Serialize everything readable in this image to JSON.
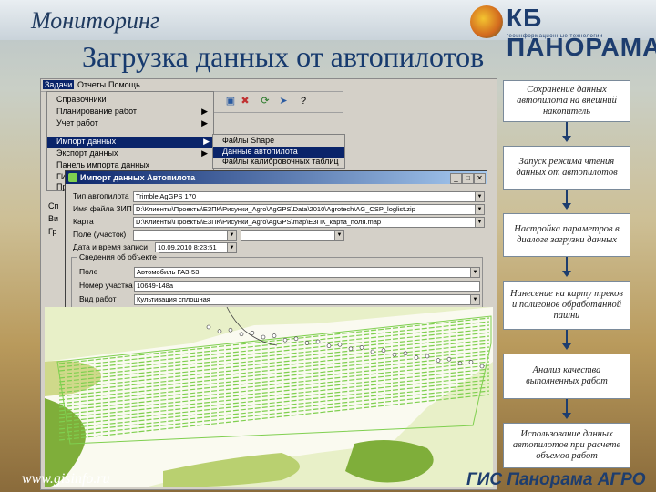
{
  "header": {
    "section_title": "Мониторинг",
    "main_title": "Загрузка данных от автопилотов"
  },
  "logo": {
    "name": "КБ ПАНОРАМА",
    "tagline": "геоинформационные технологии"
  },
  "app": {
    "menubar": [
      "Задачи",
      "Отчеты",
      "Помощь"
    ],
    "menu": [
      {
        "label": "Справочники",
        "arrow": false
      },
      {
        "label": "Планирование работ",
        "arrow": true
      },
      {
        "label": "Учет работ",
        "arrow": true
      },
      {
        "label": "Импорт данных",
        "arrow": true,
        "selected": true
      },
      {
        "label": "Экспорт данных",
        "arrow": true
      },
      {
        "label": "Панель импорта данных",
        "arrow": false
      },
      {
        "label": "ГИС",
        "arrow": false
      },
      {
        "label": "Пр",
        "arrow": false
      }
    ],
    "submenu": [
      {
        "label": "Файлы Shape"
      },
      {
        "label": "Данные автопилота",
        "selected": true
      },
      {
        "label": "Файлы калибровочных таблиц"
      }
    ],
    "side_menu_fragments": [
      "Сп",
      "Ви",
      "Гр"
    ],
    "dialog": {
      "title": "Импорт данных Автопилота",
      "fields": [
        {
          "label": "Тип автопилота",
          "value": "Trimble AgGPS 170",
          "drop": true
        },
        {
          "label": "Имя файла ЗИП",
          "value": "D:\\Клиенты\\Проекты\\ЕЗПК\\Рисунки_Agro\\AgGPS\\Data\\2010\\Agrotech\\AG_CSP_loglist.zip",
          "drop": true
        },
        {
          "label": "Карта",
          "value": "D:\\Клиенты\\Проекты\\ЕЗПК\\Рисунки_Agro\\AgGPS\\map\\ЕЗПК_карта_поля.map",
          "drop": true
        },
        {
          "label": "Поле (участок)",
          "value": "",
          "drop": true,
          "extra": ""
        },
        {
          "label": "Дата и время записи",
          "value": "10.09.2010 8:23:51",
          "drop": true
        }
      ],
      "group_title": "Сведения об объекте",
      "group_fields": [
        {
          "label": "Поле",
          "value": "Автомобиль ГАЗ-53",
          "drop": true
        },
        {
          "label": "Номер участка",
          "value": "10649-148а",
          "drop": false
        },
        {
          "label": "Вид работ",
          "value": "Культивация сплошная",
          "drop": true
        }
      ]
    }
  },
  "flowchart": {
    "steps": [
      "Сохранение данных автопилота на внешний накопитель",
      "Запуск режима чтения данных от автопилотов",
      "Настройка параметров в диалоге загрузки данных",
      "Нанесение на карту треков и полигонов обработанной пашни",
      "Анализ качества выполненных работ",
      "Использование данных автопилотов при расчете объемов работ"
    ]
  },
  "footer": {
    "website": "www.gisinfo.ru",
    "brand": "ГИС Панорама АГРО"
  },
  "colors": {
    "title": "#173a6e",
    "selection": "#0a246a",
    "track": "#7fcf4f"
  }
}
